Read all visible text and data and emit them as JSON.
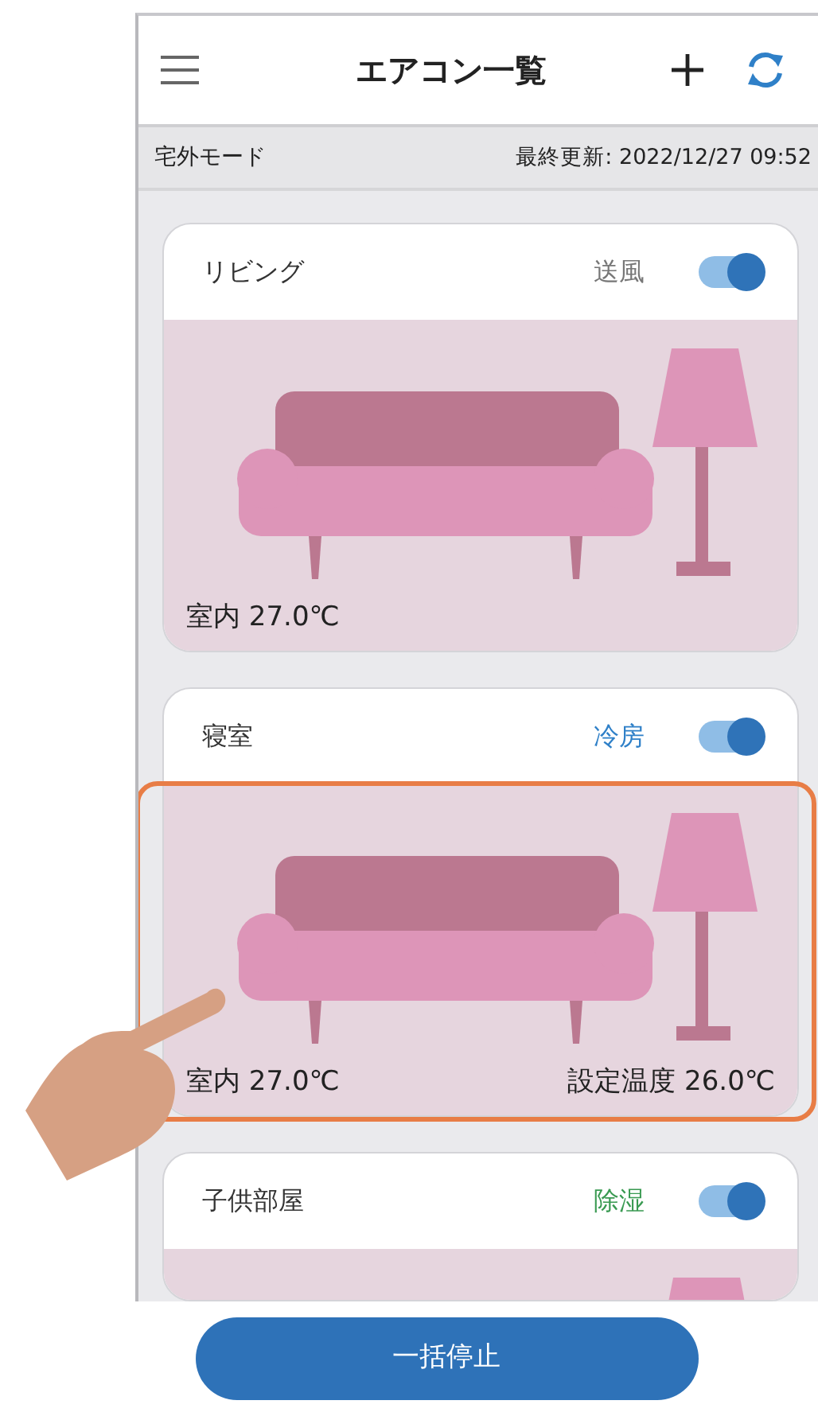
{
  "header": {
    "title": "エアコン一覧"
  },
  "status_bar": {
    "mode": "宅外モード",
    "last_updated": "最終更新: 2022/12/27 09:52"
  },
  "rooms": [
    {
      "name": "リビング",
      "mode": "送風",
      "color": "#777777",
      "on": true,
      "highlighted": false,
      "indoor": "室内 27.0℃"
    },
    {
      "name": "寝室",
      "mode": "冷房",
      "color": "#2f80c8",
      "on": true,
      "highlighted": true,
      "indoor": "室内 27.0℃",
      "setpoint": "設定温度 26.0℃"
    },
    {
      "name": "子供部屋",
      "mode": "除湿",
      "color": "#3a9a52",
      "on": true,
      "highlighted": false
    }
  ],
  "footer": {
    "button": "一括停止"
  }
}
